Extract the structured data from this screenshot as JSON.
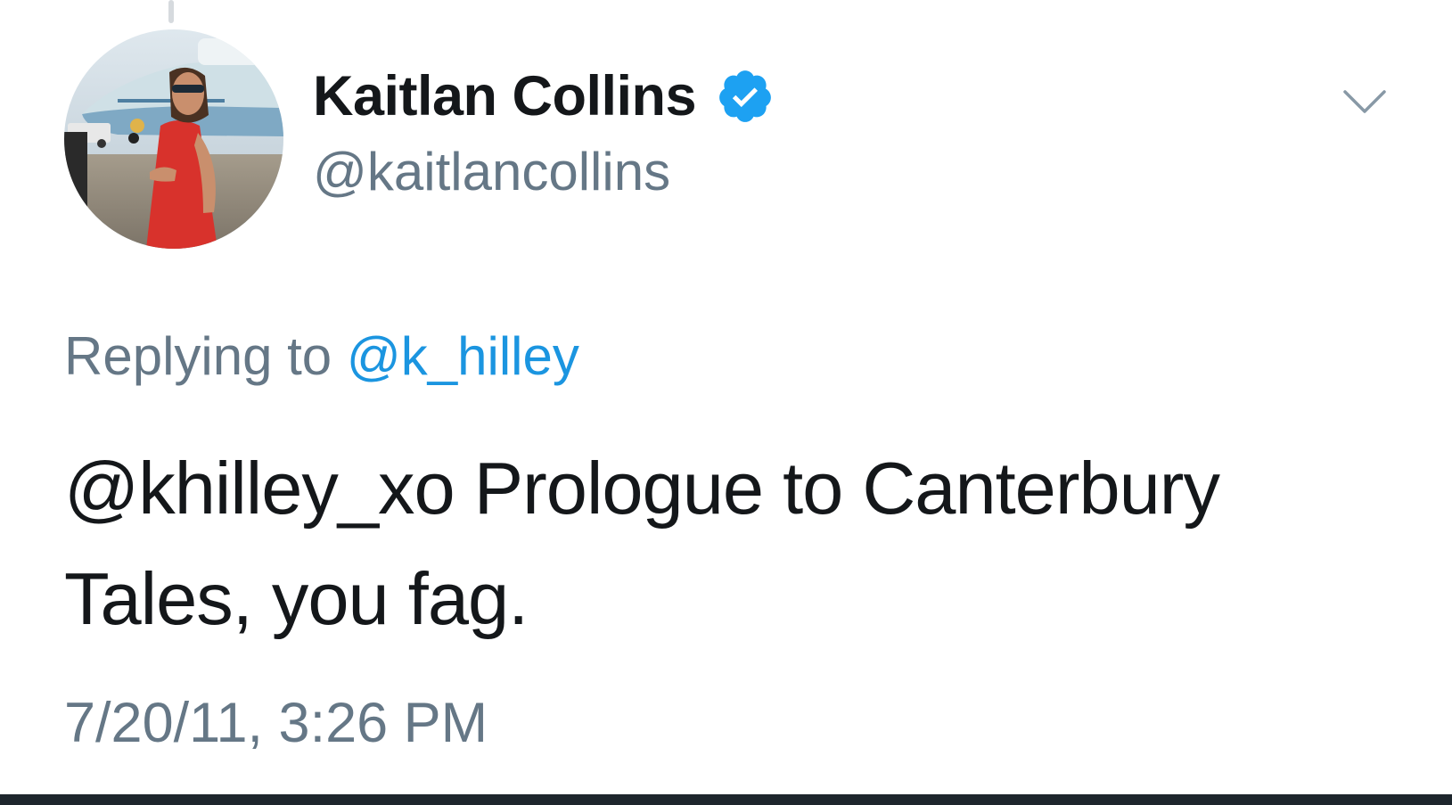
{
  "tweet": {
    "author": {
      "display_name": "Kaitlan Collins",
      "handle": "@kaitlancollins",
      "verified": true,
      "avatar_icon": "profile-photo"
    },
    "reply": {
      "prefix": "Replying to",
      "mention": "@k_hilley"
    },
    "body": {
      "mention": "@khilley_xo",
      "text": " Prologue to Canterbury Tales, you fag."
    },
    "timestamp": "7/20/11, 3:26 PM",
    "menu_icon": "chevron-down-icon"
  },
  "colors": {
    "primary_text": "#14171a",
    "secondary_text": "#657786",
    "link": "#1b95e0",
    "verified_badge": "#1da1f2",
    "bottom_bar": "#1e262d"
  }
}
